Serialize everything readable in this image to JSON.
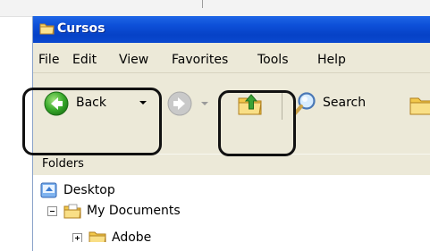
{
  "window": {
    "title": "Cursos",
    "icon": "folder-icon"
  },
  "menubar": {
    "items": [
      {
        "label": "File"
      },
      {
        "label": "Edit"
      },
      {
        "label": "View"
      },
      {
        "label": "Favorites"
      },
      {
        "label": "Tools"
      },
      {
        "label": "Help"
      }
    ]
  },
  "toolbar": {
    "back_label": "Back",
    "search_label": "Search",
    "back_icon": "back-arrow-icon",
    "forward_icon": "forward-arrow-icon",
    "up_icon": "folder-up-icon",
    "search_icon": "search-icon",
    "folders_icon": "folders-icon"
  },
  "folders_pane": {
    "header": "Folders",
    "tree": [
      {
        "label": "Desktop",
        "icon": "desktop-icon"
      },
      {
        "label": "My Documents",
        "icon": "my-documents-icon",
        "expander": "collapse"
      },
      {
        "label": "Adobe",
        "icon": "folder-icon",
        "expander": "expand"
      }
    ]
  },
  "highlight_color": "#111111",
  "colors": {
    "titlebar": "#0a48cf",
    "chrome": "#ece9d8"
  }
}
